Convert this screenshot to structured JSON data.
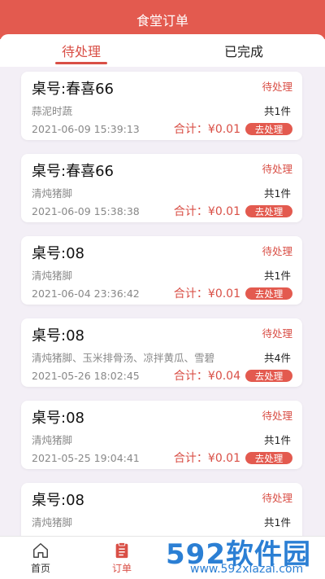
{
  "header": {
    "title": "食堂订单"
  },
  "tabs": [
    {
      "label": "待处理",
      "active": true
    },
    {
      "label": "已完成",
      "active": false
    }
  ],
  "orders": [
    {
      "table": "桌号:春喜66",
      "status": "待处理",
      "dishes": "蒜泥时蔬",
      "count": "共1件",
      "time": "2021-06-09 15:39:13",
      "total": "合计：¥0.01",
      "action": "去处理"
    },
    {
      "table": "桌号:春喜66",
      "status": "待处理",
      "dishes": "清炖猪脚",
      "count": "共1件",
      "time": "2021-06-09 15:38:38",
      "total": "合计：¥0.01",
      "action": "去处理"
    },
    {
      "table": "桌号:08",
      "status": "待处理",
      "dishes": "清炖猪脚",
      "count": "共1件",
      "time": "2021-06-04 23:36:42",
      "total": "合计：¥0.01",
      "action": "去处理"
    },
    {
      "table": "桌号:08",
      "status": "待处理",
      "dishes": "清炖猪脚、玉米排骨汤、凉拌黄瓜、雪碧",
      "count": "共4件",
      "time": "2021-05-26 18:02:45",
      "total": "合计：¥0.04",
      "action": "去处理"
    },
    {
      "table": "桌号:08",
      "status": "待处理",
      "dishes": "清炖猪脚",
      "count": "共1件",
      "time": "2021-05-25 19:04:41",
      "total": "合计：¥0.01",
      "action": "去处理"
    },
    {
      "table": "桌号:08",
      "status": "待处理",
      "dishes": "清炖猪脚",
      "count": "共1件",
      "time": "",
      "total": "",
      "action": ""
    }
  ],
  "tabbar": [
    {
      "label": "首页",
      "icon": "home-icon",
      "active": false
    },
    {
      "label": "订单",
      "icon": "order-icon",
      "active": true
    }
  ],
  "watermark": {
    "main": "592软件园",
    "sub": "www.592xiazai.com"
  },
  "colors": {
    "accent": "#e35a4f",
    "text_red": "#d94f46",
    "background": "#f3eff6"
  }
}
